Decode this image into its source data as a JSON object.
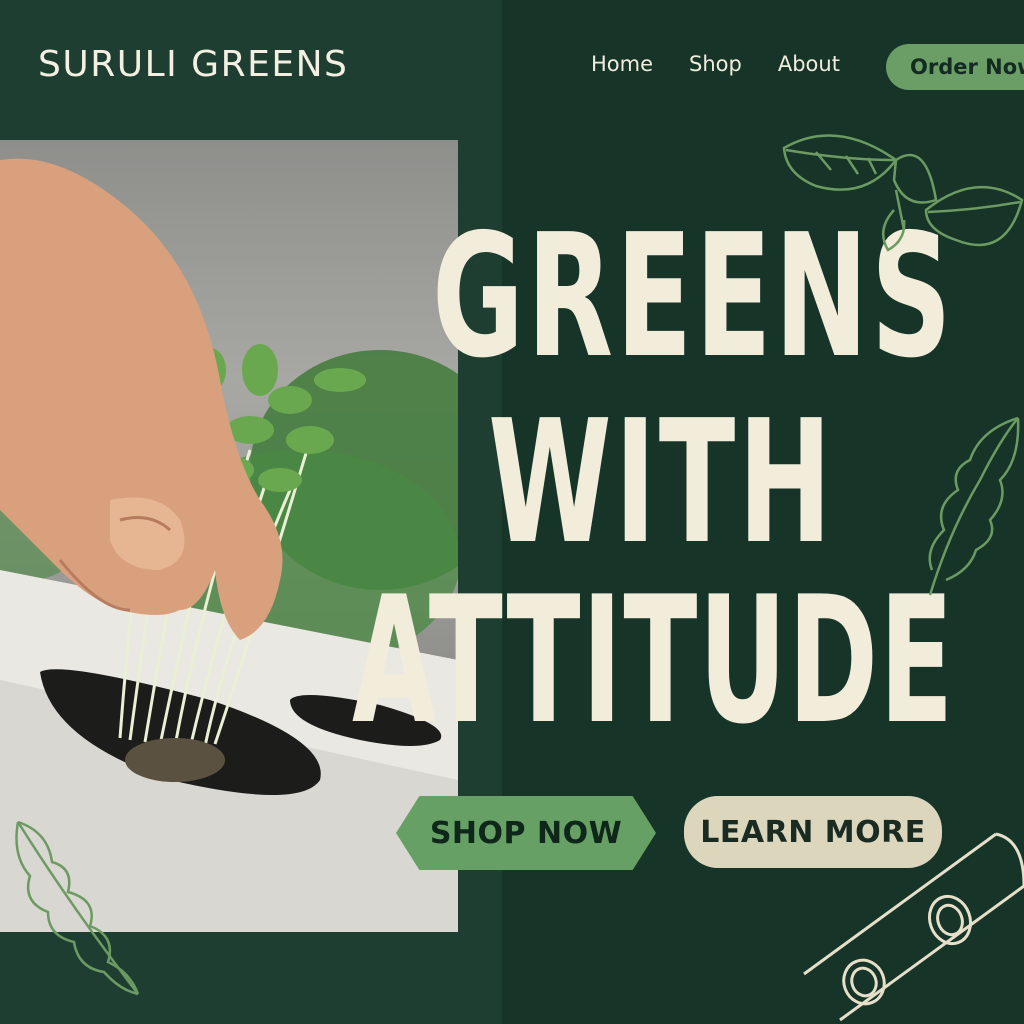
{
  "header": {
    "brand": "SURULI GREENS",
    "nav": [
      "Home",
      "Shop",
      "About"
    ],
    "order_label": "Order Now"
  },
  "hero": {
    "headline": [
      "GREENS",
      "WITH",
      "ATTITUDE"
    ],
    "shop_label": "SHOP NOW",
    "learn_label": "LEARN MORE"
  },
  "colors": {
    "background": "#163528",
    "accent": "#67a064",
    "cream": "#f2ecdb",
    "beige": "#dcd6bd"
  },
  "icons": [
    "basil-leaf-icon",
    "arugula-leaf-icon",
    "hydroponic-tube-icon"
  ]
}
